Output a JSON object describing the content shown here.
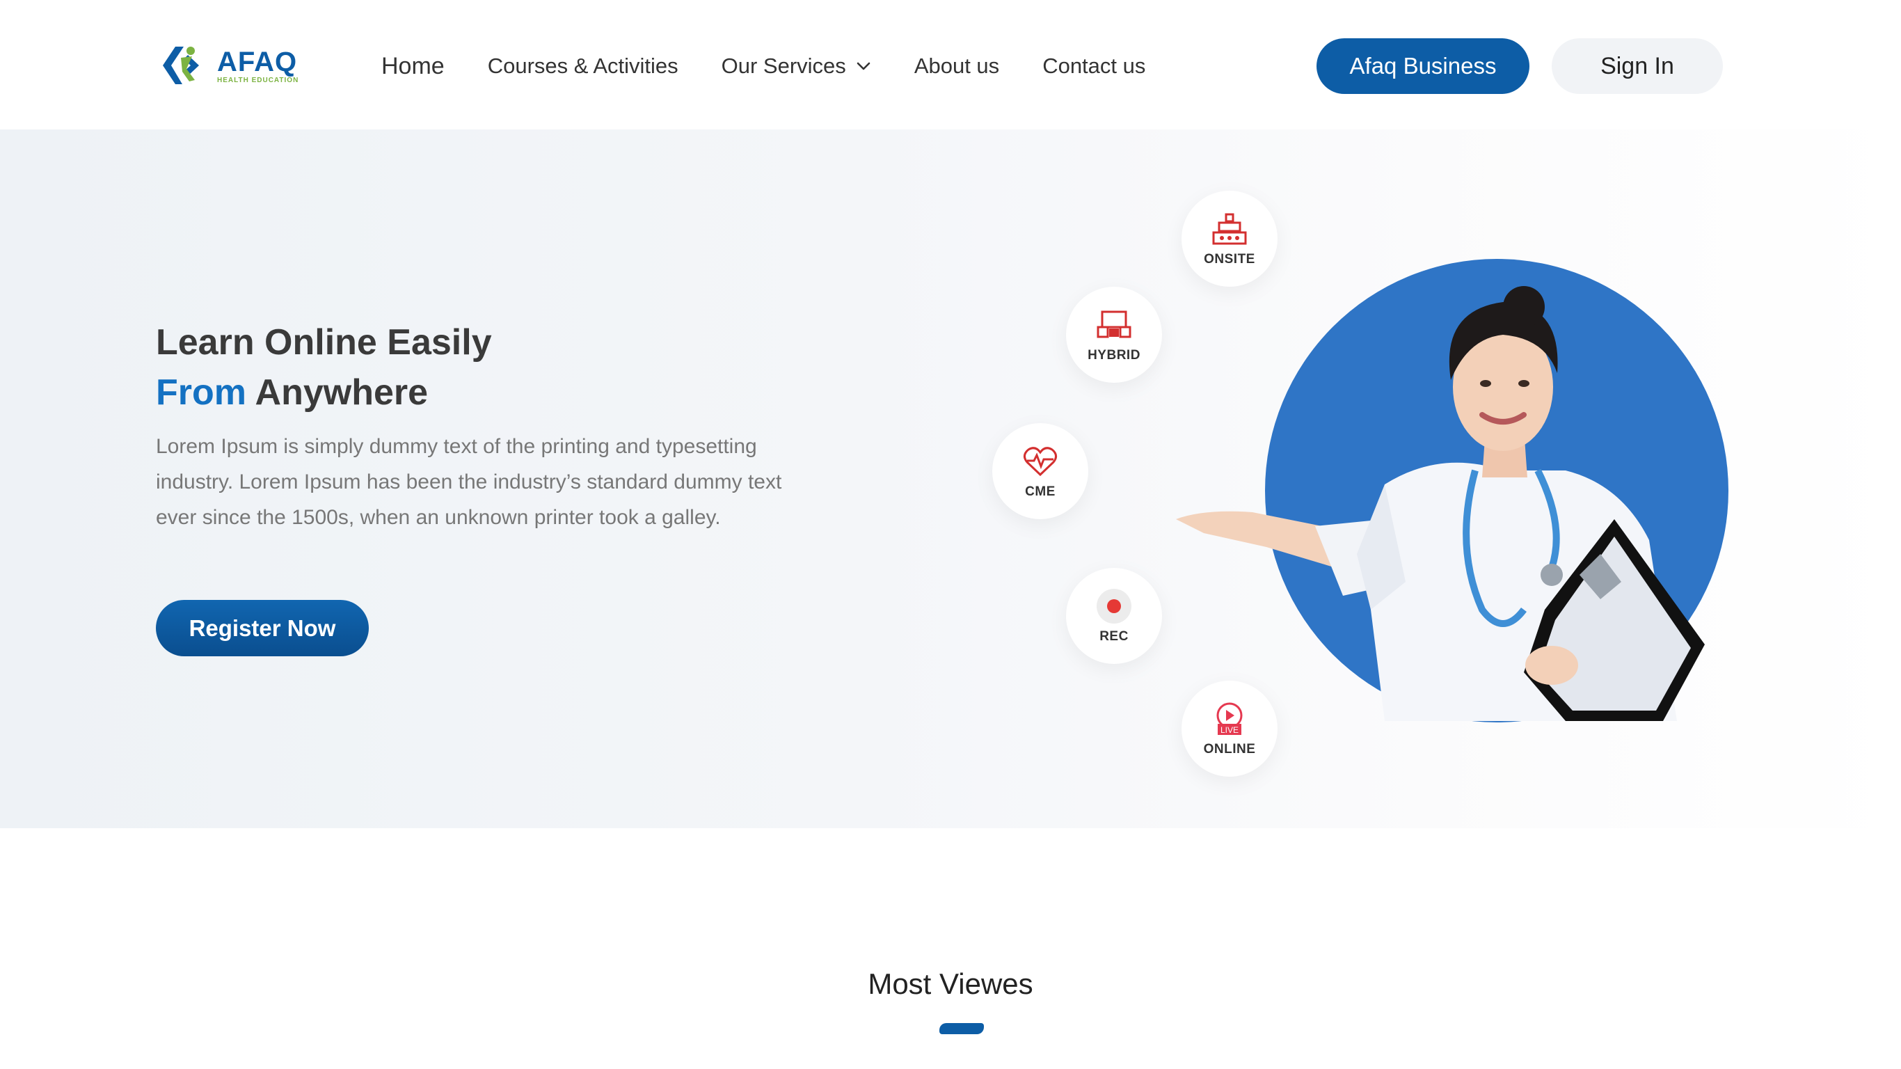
{
  "header": {
    "logo": {
      "name": "AFAQ",
      "subtitle": "HEALTH EDUCATION"
    },
    "nav": [
      {
        "label": "Home"
      },
      {
        "label": "Courses &  Activities"
      },
      {
        "label": "Our Services"
      },
      {
        "label": "About us"
      },
      {
        "label": "Contact us"
      }
    ],
    "business_button": "Afaq Business",
    "signin_button": "Sign In"
  },
  "hero": {
    "title_line1": "Learn Online Easily",
    "title_accent": "From",
    "title_rest": " Anywhere",
    "description": "Lorem Ipsum is simply dummy text of the printing and typesetting industry. Lorem Ipsum has been the industry’s standard dummy text ever since the 1500s, when an unknown printer took a galley.",
    "register_button": "Register Now",
    "modes": [
      {
        "label": "ONSITE",
        "icon": "building-icon"
      },
      {
        "label": "HYBRID",
        "icon": "hybrid-icon"
      },
      {
        "label": "CME",
        "icon": "heart-pulse-icon"
      },
      {
        "label": "REC",
        "icon": "record-icon"
      },
      {
        "label": "ONLINE",
        "icon": "live-icon",
        "badge": "LIVE"
      }
    ]
  },
  "section": {
    "title": "Most Viewes"
  },
  "colors": {
    "primary": "#0d5da6",
    "accent": "#1471c2",
    "icon_red": "#d32f2f",
    "circle": "#2f75c6"
  }
}
